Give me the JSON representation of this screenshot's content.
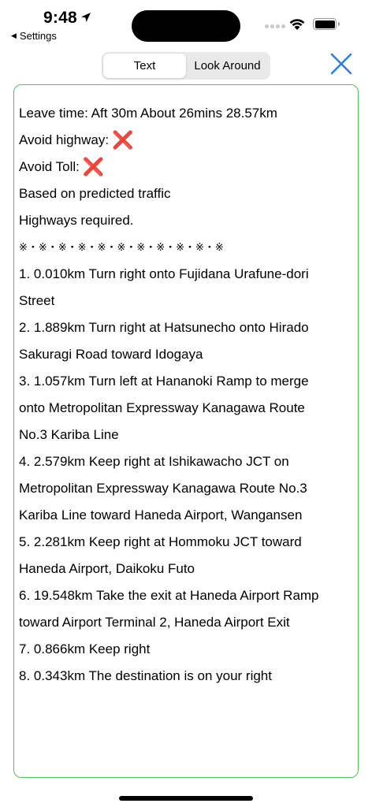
{
  "status": {
    "time": "9:48",
    "back_label": "Settings"
  },
  "segmented": {
    "options": [
      "Text",
      "Look Around"
    ],
    "selected": "Text"
  },
  "route": {
    "summary": "Leave time: Aft 30m    About 26mins  28.57km",
    "avoid_highway": "Avoid highway:",
    "avoid_toll": "Avoid Toll:",
    "cross_mark": "❌",
    "traffic_note": "Based on predicted traffic",
    "highways_note": "Highways required.",
    "separator": "※・※・※・※・※・※・※・※・※・※・※",
    "steps": [
      "1. 0.010km Turn right onto Fujidana Urafune-dori",
      "Street",
      "2. 1.889km Turn right at Hatsunecho onto Hirado",
      "Sakuragi Road toward Idogaya",
      "3. 1.057km Turn left at Hananoki Ramp to merge",
      "onto Metropolitan Expressway Kanagawa Route",
      "No.3 Kariba Line",
      "4. 2.579km Keep right at Ishikawacho JCT on",
      "Metropolitan Expressway Kanagawa Route No.3",
      "Kariba Line toward Haneda Airport, Wangansen",
      "5. 2.281km Keep right at Hommoku JCT toward",
      "Haneda Airport, Daikoku Futo",
      "6. 19.548km Take the exit at Haneda Airport Ramp",
      "toward Airport Terminal 2, Haneda Airport Exit",
      "7. 0.866km Keep right",
      "8. 0.343km The destination is on your right"
    ]
  },
  "colors": {
    "accent": "#2f7fe0",
    "border": "#4cc35a",
    "cross": "#e0191f"
  }
}
